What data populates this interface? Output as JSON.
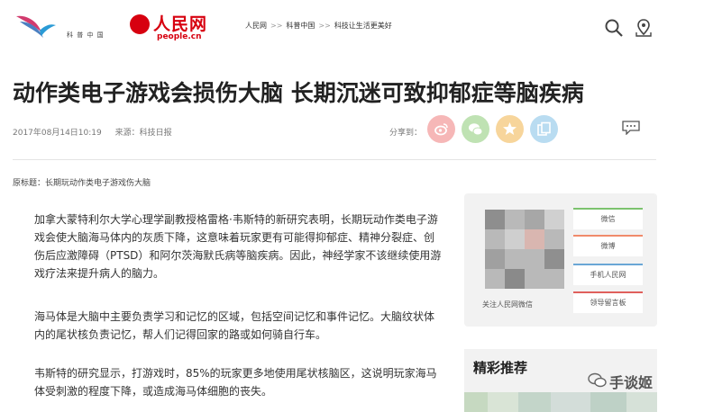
{
  "header": {
    "logo1_caption": "科 普 中 国",
    "logo2_text": "人民网",
    "logo2_sub": "people.cn",
    "breadcrumb": [
      "人民网",
      "科普中国",
      "科技让生活更美好"
    ],
    "breadcrumb_sep": ">>",
    "search_icon": "search-icon",
    "location_icon": "location-pin-icon"
  },
  "article": {
    "title": "动作类电子游戏会损伤大脑 长期沉迷可致抑郁症等脑疾病",
    "date": "2017年08月14日10:19",
    "source": "来源：科技日报",
    "share_label": "分享到：",
    "original_title": "原标题：长期玩动作类电子游戏伤大脑",
    "paragraphs": [
      "加拿大蒙特利尔大学心理学副教授格雷格·韦斯特的新研究表明，长期玩动作类电子游戏会使大脑海马体内的灰质下降，这意味着玩家更有可能得抑郁症、精神分裂症、创伤后应激障碍（PTSD）和阿尔茨海默氏病等脑疾病。因此，神经学家不该继续使用游戏疗法来提升病人的脑力。",
      "海马体是大脑中主要负责学习和记忆的区域，包括空间记忆和事件记忆。大脑纹状体内的尾状核负责记忆，帮人们记得回家的路或如何骑自行车。",
      "韦斯特的研究显示，打游戏时，85%的玩家更多地使用尾状核脑区，这说明玩家海马体受刺激的程度下降，或造成海马体细胞的丧失。"
    ]
  },
  "share_buttons": [
    {
      "name": "weibo-icon",
      "color": "#f6b7b7"
    },
    {
      "name": "wechat-icon",
      "color": "#bfe2b3"
    },
    {
      "name": "qzone-star-icon",
      "color": "#f7d59b"
    },
    {
      "name": "copy-link-icon",
      "color": "#b9dcf1"
    }
  ],
  "comment_icon": "comment-icon",
  "sidebar": {
    "qr_caption": "关注人民网微信",
    "buttons": [
      {
        "label": "微信",
        "color": "#7cc26e"
      },
      {
        "label": "微博",
        "color": "#f08a6b"
      },
      {
        "label": "手机人民网",
        "color": "#6aa7d6"
      },
      {
        "label": "领导留言板",
        "color": "#e0605c"
      }
    ],
    "recommend_title": "精彩推荐"
  },
  "watermark": {
    "text": "手谈姬",
    "icon": "wechat-bubble-icon"
  }
}
